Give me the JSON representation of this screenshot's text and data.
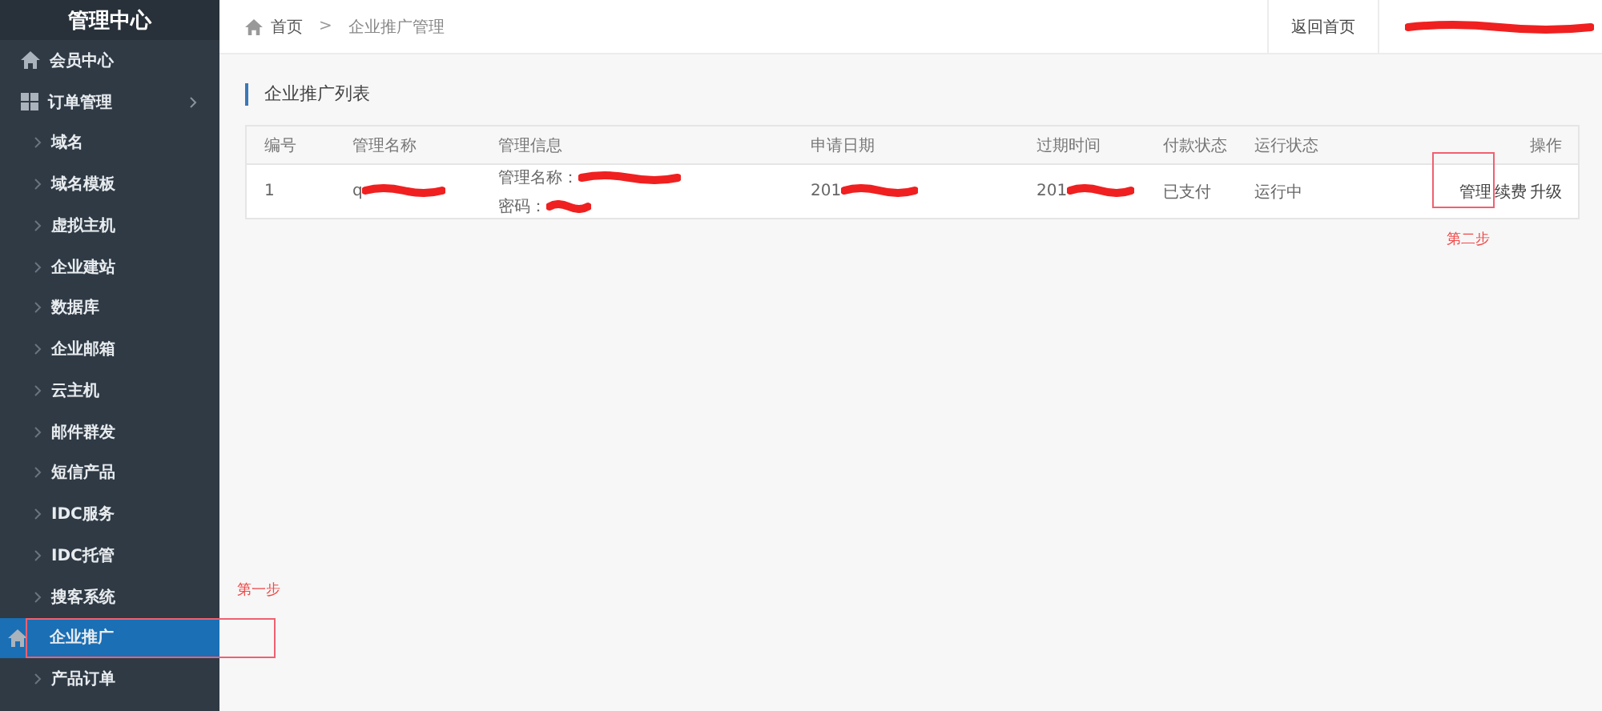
{
  "sidebar": {
    "title": "管理中心",
    "items": [
      {
        "label": "会员中心",
        "kind": "home",
        "selected": false
      },
      {
        "label": "订单管理",
        "kind": "grid",
        "selected": false
      },
      {
        "label": "域名",
        "kind": "sub",
        "selected": false
      },
      {
        "label": "域名模板",
        "kind": "sub",
        "selected": false
      },
      {
        "label": "虚拟主机",
        "kind": "sub",
        "selected": false
      },
      {
        "label": "企业建站",
        "kind": "sub",
        "selected": false
      },
      {
        "label": "数据库",
        "kind": "sub",
        "selected": false
      },
      {
        "label": "企业邮箱",
        "kind": "sub",
        "selected": false
      },
      {
        "label": "云主机",
        "kind": "sub",
        "selected": false
      },
      {
        "label": "邮件群发",
        "kind": "sub",
        "selected": false
      },
      {
        "label": "短信产品",
        "kind": "sub",
        "selected": false
      },
      {
        "label": "IDC服务",
        "kind": "sub",
        "selected": false
      },
      {
        "label": "IDC托管",
        "kind": "sub",
        "selected": false
      },
      {
        "label": "搜客系统",
        "kind": "sub",
        "selected": false
      },
      {
        "label": "企业推广",
        "kind": "home",
        "selected": true
      },
      {
        "label": "产品订单",
        "kind": "sub",
        "selected": false
      }
    ]
  },
  "breadcrumb": [
    "首页",
    "企业推广管理"
  ],
  "breadcrumb_separator": ">",
  "topbar": {
    "home_button": "返回首页"
  },
  "panel_title": "企业推广列表",
  "table": {
    "columns": [
      "编号",
      "管理名称",
      "管理信息",
      "申请日期",
      "过期时间",
      "付款状态",
      "运行状态",
      "操作"
    ],
    "rows": [
      {
        "number": "1",
        "name": "q",
        "info": [
          "管理名称：",
          "密码："
        ],
        "applied": "201",
        "expires": "201",
        "payment": "已支付",
        "status": "运行中",
        "actions": [
          "管理",
          "续费",
          "升级"
        ]
      }
    ]
  },
  "annotations": [
    "第一步",
    "第二步"
  ]
}
